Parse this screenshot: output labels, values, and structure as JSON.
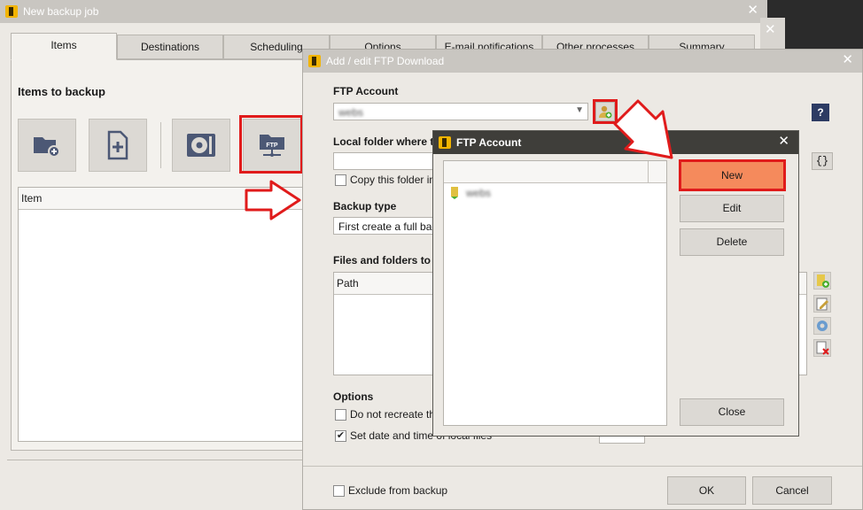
{
  "backup_window": {
    "title": "New backup job",
    "tabs": [
      "Items",
      "Destinations",
      "Scheduling",
      "Options",
      "E-mail notifications",
      "Other processes",
      "Summary"
    ],
    "section_title": "Items to backup",
    "list_header": "Item",
    "toolbar_icons": [
      "add-folder-icon",
      "add-file-icon",
      "disk-image-icon",
      "ftp-folder-icon"
    ],
    "ftp_icon_label": "FTP"
  },
  "ftp_download_dialog": {
    "title": "Add / edit FTP Download",
    "ftp_account_label": "FTP Account",
    "ftp_account_value": "webs",
    "local_folder_label": "Local folder where to",
    "copy_folder_label": "Copy this folder in t",
    "backup_type_label": "Backup type",
    "backup_type_value": "First create a full back",
    "files_folders_label": "Files and folders to b",
    "path_header": "Path",
    "options_label": "Options",
    "option_no_recreate": "Do not recreate the",
    "option_set_date": "Set date and time of local files",
    "exclude_label": "Exclude from backup",
    "help_button": "?",
    "braces_button": "{}",
    "ok_button": "OK",
    "cancel_button": "Cancel"
  },
  "ftp_account_dialog": {
    "title": "FTP Account",
    "account_item": "webs",
    "new_button": "New",
    "edit_button": "Edit",
    "delete_button": "Delete",
    "close_button": "Close"
  },
  "colors": {
    "annotation_red": "#e01b1b",
    "new_button_highlight": "#f58a5c",
    "icon_slate": "#4c5875"
  }
}
